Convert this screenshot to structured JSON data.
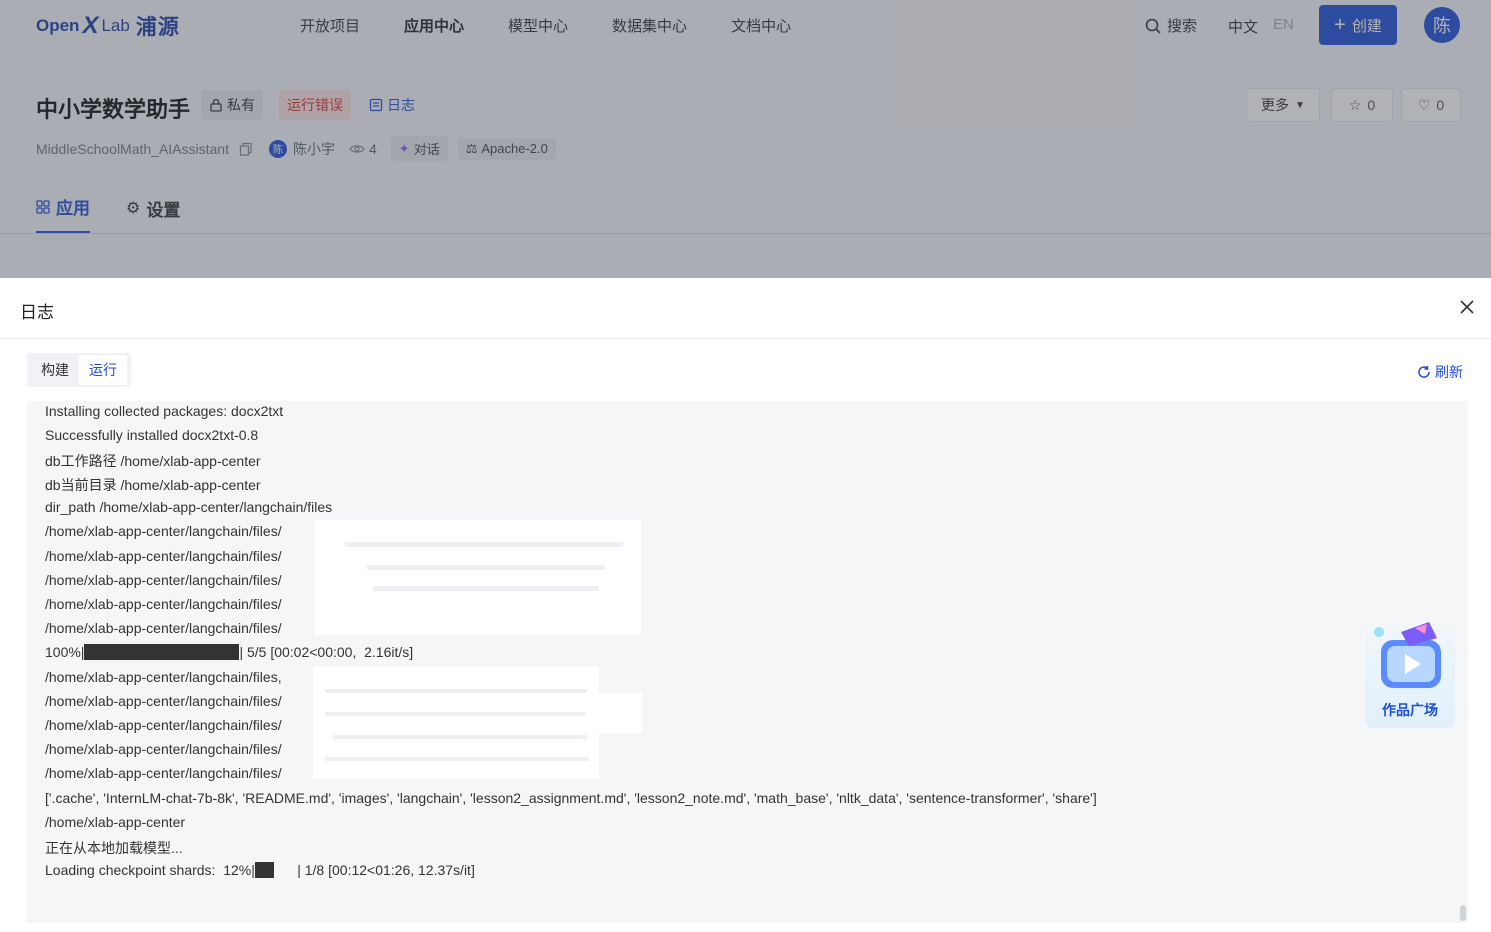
{
  "header": {
    "logo_open": "Open",
    "logo_x": "X",
    "logo_lab": "Lab",
    "logo_cn": "浦源",
    "nav": [
      "开放项目",
      "应用中心",
      "模型中心",
      "数据集中心",
      "文档中心"
    ],
    "search_label": "搜索",
    "lang_zh": "中文",
    "lang_en": "EN",
    "create_label": "创建",
    "avatar_text": "陈"
  },
  "app": {
    "title": "中小学数学助手",
    "private_label": "私有",
    "status_label": "运行错误",
    "log_label": "日志",
    "more_label": "更多",
    "star_count": "0",
    "like_count": "0",
    "repo_name": "MiddleSchoolMath_AIAssistant",
    "owner_avatar": "陈",
    "owner": "陈小宇",
    "views": "4",
    "type_label": "对话",
    "license": "Apache-2.0",
    "tabs": [
      "应用",
      "设置"
    ]
  },
  "drawer": {
    "title": "日志",
    "segments": [
      "构建",
      "运行"
    ],
    "refresh_label": "刷新",
    "log_lines": [
      "Installing collected packages: docx2txt",
      "Successfully installed docx2txt-0.8",
      "db工作路径 /home/xlab-app-center",
      "db当前目录 /home/xlab-app-center",
      "dir_path /home/xlab-app-center/langchain/files",
      "/home/xlab-app-center/langchain/files/",
      "/home/xlab-app-center/langchain/files/",
      "/home/xlab-app-center/langchain/files/",
      "/home/xlab-app-center/langchain/files/",
      "/home/xlab-app-center/langchain/files/",
      "100%|",
      "/home/xlab-app-center/langchain/files,",
      "/home/xlab-app-center/langchain/files/",
      "/home/xlab-app-center/langchain/files/",
      "/home/xlab-app-center/langchain/files/",
      "/home/xlab-app-center/langchain/files/",
      "['.cache', 'InternLM-chat-7b-8k', 'README.md', 'images', 'langchain', 'lesson2_assignment.md', 'lesson2_note.md', 'math_base', 'nltk_data', 'sentence-transformer', 'share']",
      "/home/xlab-app-center",
      "正在从本地加载模型...",
      "Loading checkpoint shards:  12%|"
    ],
    "progress_1_tail": "| 5/5 [00:02<00:00,  2.16it/s]",
    "progress_1_fraction": 1.0,
    "progress_2_tail": "      | 1/8 [00:12<01:26, 12.37s/it]",
    "progress_2_fraction": 0.125
  },
  "widget": {
    "label": "作品广场"
  }
}
